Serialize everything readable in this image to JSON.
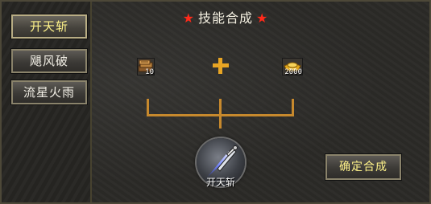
{
  "sidebar": {
    "items": [
      {
        "label": "开天斩"
      },
      {
        "label": "飓风破"
      },
      {
        "label": "流星火雨"
      }
    ]
  },
  "panel": {
    "title": "技能合成",
    "title_star": "★",
    "materials": [
      {
        "icon": "book-bundle-icon",
        "quantity": "10"
      },
      {
        "icon": "gold-ingot-icon",
        "quantity": "2000"
      }
    ],
    "plus_icon": "plus-icon",
    "result_skill": {
      "icon": "sword-skill-icon",
      "label": "开天斩"
    },
    "confirm_label": "确定合成"
  },
  "colors": {
    "accent_gold": "#fff38a",
    "star_red": "#ff2a1a",
    "connector": "#c7892d"
  }
}
